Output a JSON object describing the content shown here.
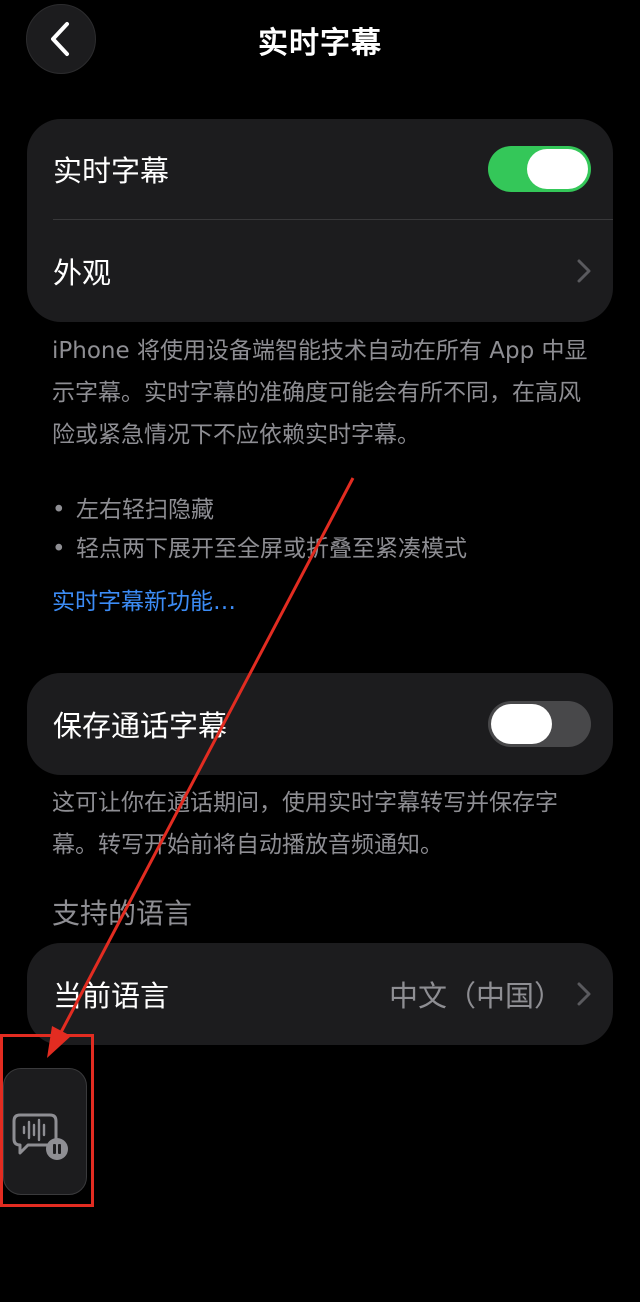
{
  "header": {
    "title": "实时字幕"
  },
  "settings": {
    "live_captions": {
      "label": "实时字幕",
      "enabled": true
    },
    "appearance": {
      "label": "外观"
    },
    "description": "iPhone 将使用设备端智能技术自动在所有 App 中显示字幕。实时字幕的准确度可能会有所不同，在高风险或紧急情况下不应依赖实时字幕。",
    "bullets": [
      "左右轻扫隐藏",
      "轻点两下展开至全屏或折叠至紧凑模式"
    ],
    "bullet_symbol": "•",
    "whats_new_link": "实时字幕新功能…",
    "save_call_captions": {
      "label": "保存通话字幕",
      "enabled": false
    },
    "save_description": "这可让你在通话期间，使用实时字幕转写并保存字幕。转写开始前将自动播放音频通知。",
    "languages_section": "支持的语言",
    "current_language": {
      "label": "当前语言",
      "value": "中文（中国）"
    }
  },
  "icons": {
    "back": "chevron-left-icon",
    "disclosure": "chevron-right-icon",
    "floating_widget": "live-captions-paused-icon"
  },
  "colors": {
    "toggle_on": "#34c759",
    "link": "#3c8cf6",
    "annotation": "#e22c21"
  }
}
